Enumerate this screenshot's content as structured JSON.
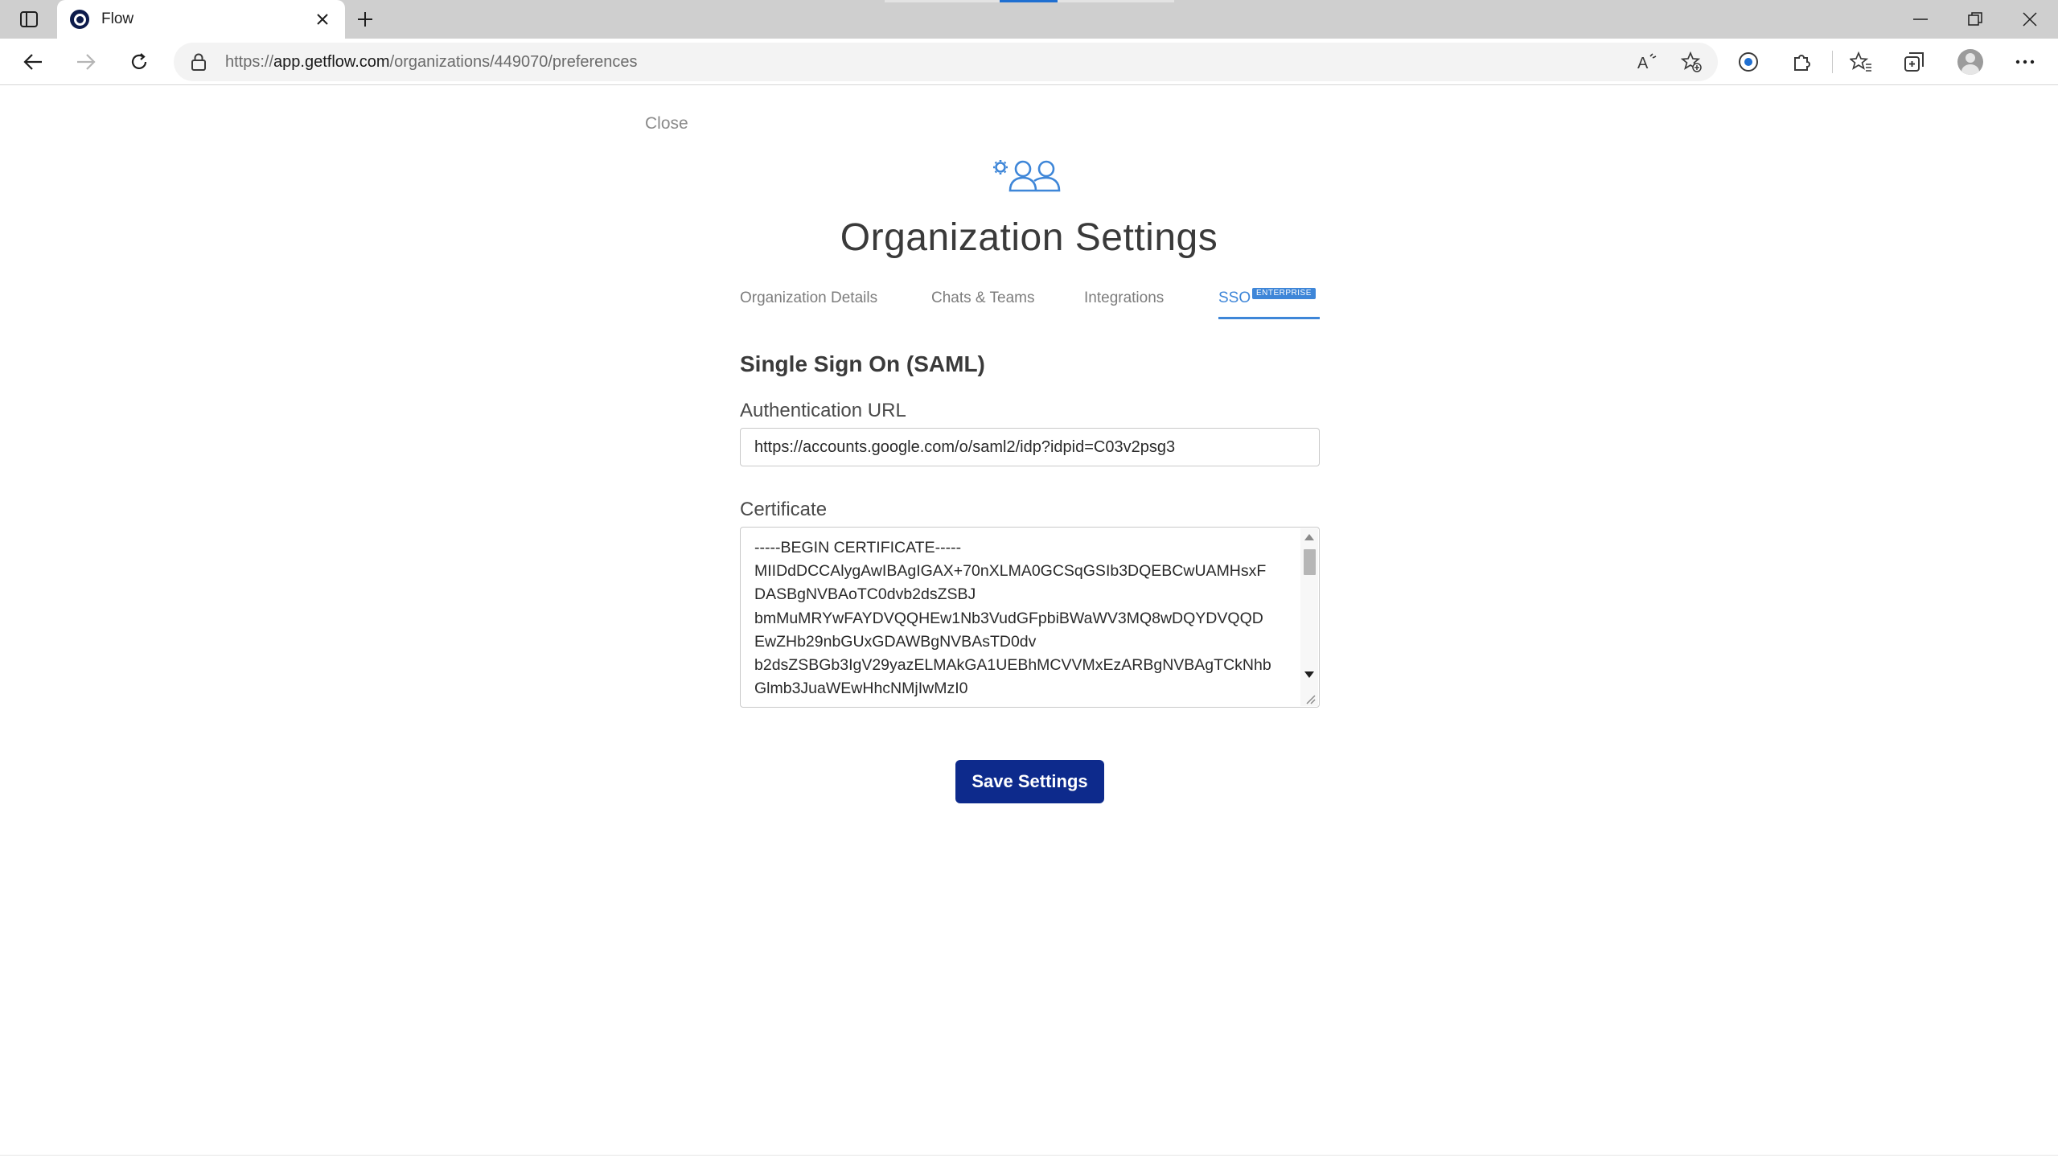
{
  "browser": {
    "tab_title": "Flow",
    "url_prefix": "https://",
    "url_host": "app.getflow.com",
    "url_path": "/organizations/449070/preferences",
    "icons": [
      "sidebar-toggle-icon",
      "flow-favicon-icon",
      "close-icon",
      "plus-icon",
      "minimize-icon",
      "restore-icon",
      "window-close-icon",
      "back-icon",
      "forward-icon",
      "refresh-icon",
      "lock-icon",
      "read-aloud-icon",
      "add-favorite-icon",
      "tracking-icon",
      "extensions-icon",
      "favorites-icon",
      "collections-icon",
      "profile-icon",
      "more-icon"
    ]
  },
  "page": {
    "close_label": "Close",
    "title": "Organization Settings",
    "tabs": [
      {
        "label": "Organization Details",
        "active": false
      },
      {
        "label": "Chats & Teams",
        "active": false
      },
      {
        "label": "Integrations",
        "active": false
      },
      {
        "label": "SSO",
        "active": true,
        "badge": "ENTERPRISE"
      }
    ],
    "section_title": "Single Sign On (SAML)",
    "auth_url": {
      "label": "Authentication URL",
      "value": "https://accounts.google.com/o/saml2/idp?idpid=C03v2psg3"
    },
    "certificate": {
      "label": "Certificate",
      "value": "-----BEGIN CERTIFICATE-----\nMIIDdDCCAlygAwIBAgIGAX+70nXLMA0GCSqGSIb3DQEBCwUAMHsxF\nDASBgNVBAoTC0dvb2dsZSBJ\nbmMuMRYwFAYDVQQHEw1Nb3VudGFpbiBWaWV3MQ8wDQYDVQQD\nEwZHb29nbGUxGDAWBgNVBAsTD0dv\nb2dsZSBGb3IgV29yazELMAkGA1UEBhMCVVMxEzARBgNVBAgTCkNhb\nGlmb3JuaWEwHhcNMjIwMzI0"
    },
    "save_label": "Save Settings",
    "accent_color": "#3e86d8",
    "button_color": "#0d2a8c"
  }
}
